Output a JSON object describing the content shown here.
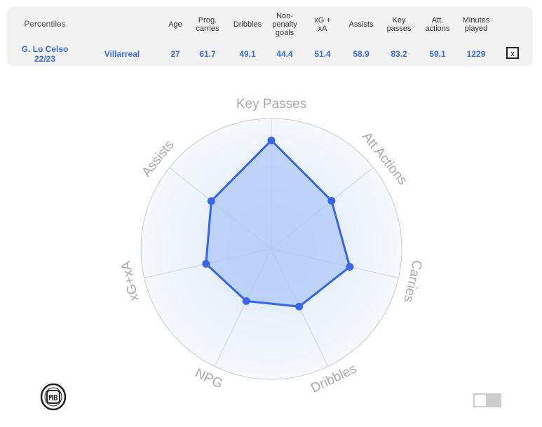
{
  "table": {
    "headers": [
      "Percentiles",
      "Age",
      "Prog. carries",
      "Dribbles",
      "Non-penalty goals",
      "xG + xA",
      "Assists",
      "Key passes",
      "Att. actions",
      "Minutes played"
    ],
    "row": {
      "player": "G. Lo Celso 22/23",
      "team": "Villarreal",
      "values": [
        "27",
        "61.7",
        "49.1",
        "44.4",
        "51.4",
        "58.9",
        "83.2",
        "59.1",
        "1229"
      ]
    },
    "close_label": "x"
  },
  "chart_data": {
    "type": "radar",
    "categories": [
      "Key Passes",
      "Att Actions",
      "Carries",
      "Dribbles",
      "NPG",
      "xG+xA",
      "Assists"
    ],
    "values": [
      83.2,
      59.1,
      61.7,
      49.1,
      44.4,
      51.4,
      58.9
    ],
    "range": [
      0,
      100
    ],
    "colors": {
      "line": "#3366ee",
      "fill": "#a9c2f7",
      "point": "#3a66ee"
    }
  },
  "logo": "MB",
  "toggle": {
    "on": false
  }
}
